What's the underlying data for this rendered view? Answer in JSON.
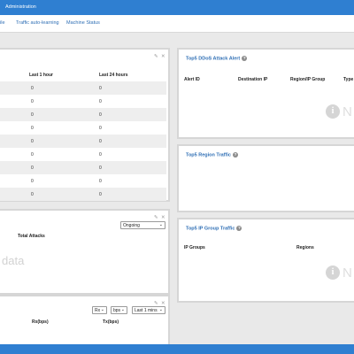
{
  "topbar": {
    "title": "Administration"
  },
  "nav": {
    "tabs": [
      "ile",
      "Traffic auto-learning",
      "Machine Status"
    ]
  },
  "traffic_table": {
    "headers": [
      "Last 1 hour",
      "Last 24 hours"
    ],
    "rows": [
      [
        "0",
        "0"
      ],
      [
        "0",
        "0"
      ],
      [
        "0",
        "0"
      ],
      [
        "0",
        "0"
      ],
      [
        "0",
        "0"
      ],
      [
        "0",
        "0"
      ],
      [
        "0",
        "0"
      ],
      [
        "0",
        "0"
      ],
      [
        "0",
        "0"
      ]
    ]
  },
  "attacks_panel": {
    "header": "Total Attacks",
    "select_value": "Ongoing",
    "nodata_text": "data"
  },
  "rate_panel": {
    "select_rx": "Rx",
    "select_unit": "bps",
    "select_range": "Last 1 mins",
    "header_rx": "Rx(bps)",
    "header_tx": "Tx(bps)"
  },
  "ddos_alert": {
    "title": "Top5 DDoS Attack Alert",
    "columns": [
      "Alert ID",
      "Destination IP",
      "Region/IP Group",
      "Type"
    ],
    "nodata_icon_letter": "i",
    "nodata_text": "N"
  },
  "region_traffic": {
    "title": "Top5 Region Traffic"
  },
  "ip_group_traffic": {
    "title": "Top5 IP Group Traffic",
    "columns": [
      "IP Groups",
      "Regions"
    ],
    "nodata_icon_letter": "i",
    "nodata_text": "N"
  }
}
